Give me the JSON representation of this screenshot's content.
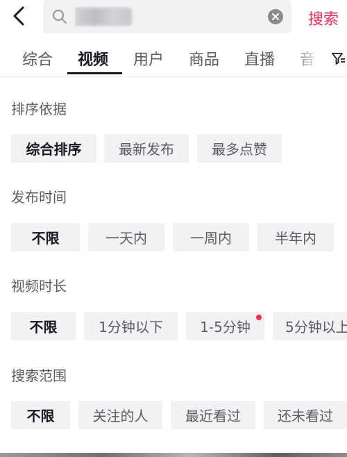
{
  "header": {
    "search_placeholder": "",
    "search_button_label": "搜索"
  },
  "tabs": [
    {
      "label": "综合"
    },
    {
      "label": "视频"
    },
    {
      "label": "用户"
    },
    {
      "label": "商品"
    },
    {
      "label": "直播"
    },
    {
      "label": "音"
    }
  ],
  "active_tab": "视频",
  "sections": [
    {
      "title": "排序依据",
      "options": [
        "综合排序",
        "最新发布",
        "最多点赞"
      ],
      "selected": "综合排序"
    },
    {
      "title": "发布时间",
      "options": [
        "不限",
        "一天内",
        "一周内",
        "半年内"
      ],
      "selected": "不限"
    },
    {
      "title": "视频时长",
      "options": [
        "不限",
        "1分钟以下",
        "1-5分钟",
        "5分钟以上"
      ],
      "selected": "不限",
      "dot_option": "1-5分钟"
    },
    {
      "title": "搜索范围",
      "options": [
        "不限",
        "关注的人",
        "最近看过",
        "还未看过"
      ],
      "selected": "不限"
    }
  ],
  "colors": {
    "accent": "#fe2c55",
    "text_primary": "#161823",
    "text_secondary": "#5b5c63",
    "chip_bg": "#f2f2f4"
  },
  "icons": {
    "back": "chevron-left-icon",
    "search": "magnifier-icon",
    "clear": "clear-circle-icon",
    "filter": "filter-icon"
  }
}
